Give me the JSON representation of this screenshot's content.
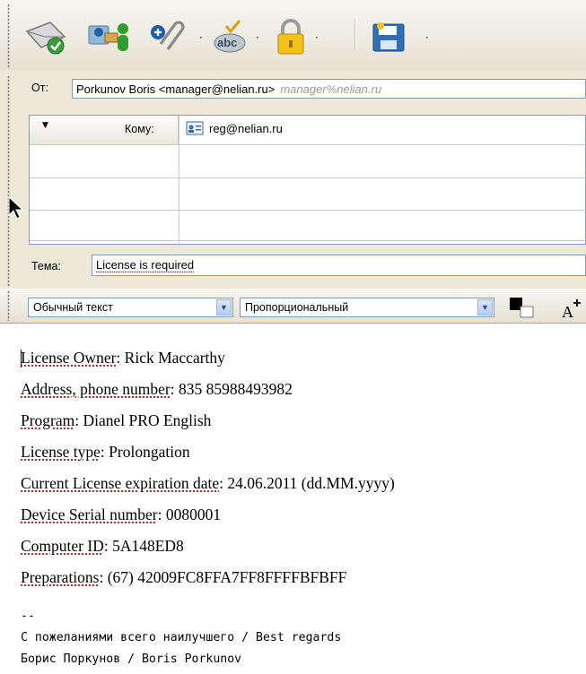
{
  "header": {
    "from_label": "От:",
    "from_value": "Porkunov Boris <manager@nelian.ru>",
    "from_hint": "manager%nelian.ru",
    "to_type_label": "Кому:",
    "to_value": "reg@nelian.ru",
    "subject_label": "Тема:",
    "subject_value": "License is required"
  },
  "format_bar": {
    "paragraph_style": "Обычный текст",
    "font_family": "Пропорциональный"
  },
  "body": {
    "lines": [
      {
        "k": "License Owner",
        "v": ": Rick Maccarthy"
      },
      {
        "k": "Address, phone number",
        "v": ": 835 85988493982"
      },
      {
        "k": "Program",
        "v": ": Dianel PRO English"
      },
      {
        "k": "License type",
        "v": ": Prolongation"
      },
      {
        "k": "Current License expiration date",
        "v": ": 24.06.2011 (dd.MM.yyyy)"
      },
      {
        "k": "Device Serial number",
        "v": ": 0080001"
      },
      {
        "k": "Computer ID",
        "v": ": 5A148ED8"
      },
      {
        "k": "Preparations",
        "v": ": (67) 42009FC8FFA7FF8FFFFBFBFF"
      }
    ],
    "signature_sep": "--",
    "signature_1": "С пожеланиями всего наилучшего / Best regards",
    "signature_2": "Борис Поркунов / Boris Porkunov"
  }
}
